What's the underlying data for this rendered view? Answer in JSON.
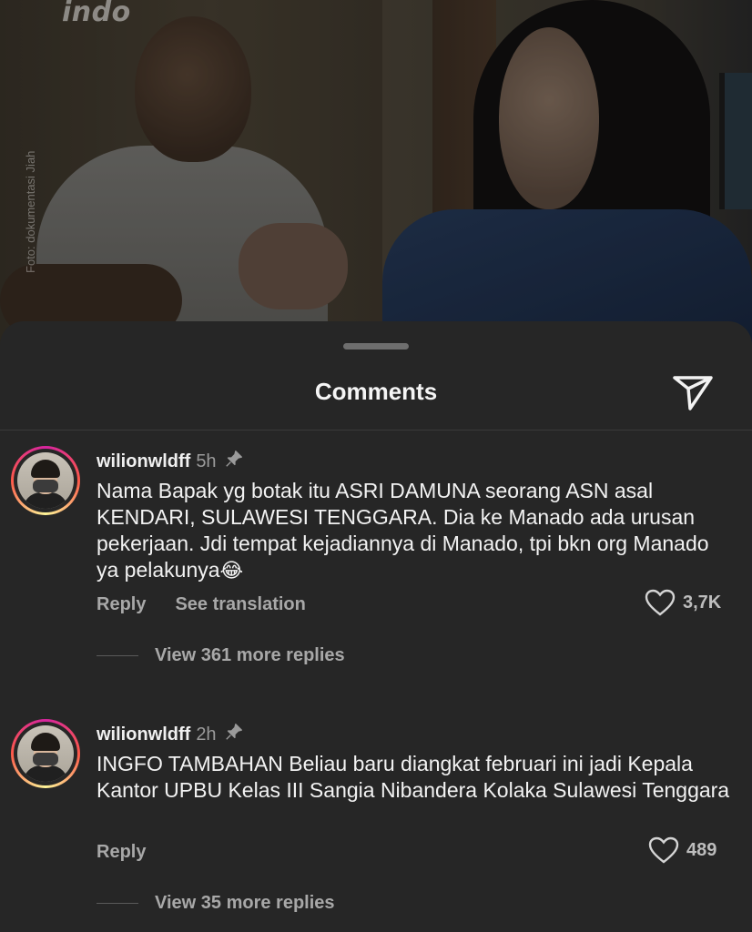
{
  "background": {
    "watermark": "indo",
    "photo_credit": "Foto: dokumentasi Jiah"
  },
  "sheet": {
    "title": "Comments",
    "share_icon": "send-icon"
  },
  "comments": [
    {
      "username": "wilionwldff",
      "time": "5h",
      "pinned": true,
      "text_main": "Nama Bapak yg botak itu ASRI DAMUNA seorang ASN asal KENDARI, SULAWESI TENGGARA. Dia ke Manado ada urusan pekerjaan. Jdi tempat kejadiannya di Manado, tpi bkn org Manado ya pelakunya",
      "emoji": "😂",
      "reply_label": "Reply",
      "translate_label": "See translation",
      "likes": "3,7K",
      "view_replies": "View 361 more replies"
    },
    {
      "username": "wilionwldff",
      "time": "2h",
      "pinned": true,
      "text_main": "INGFO TAMBAHAN Beliau baru diangkat februari ini jadi Kepala Kantor UPBU Kelas III Sangia Nibandera Kolaka Sulawesi Tenggara",
      "reply_label": "Reply",
      "likes": "489",
      "view_replies": "View 35 more replies"
    }
  ],
  "colors": {
    "sheet_bg": "#262626",
    "text_primary": "#f2f2f2",
    "text_secondary": "#a8a8a8"
  }
}
